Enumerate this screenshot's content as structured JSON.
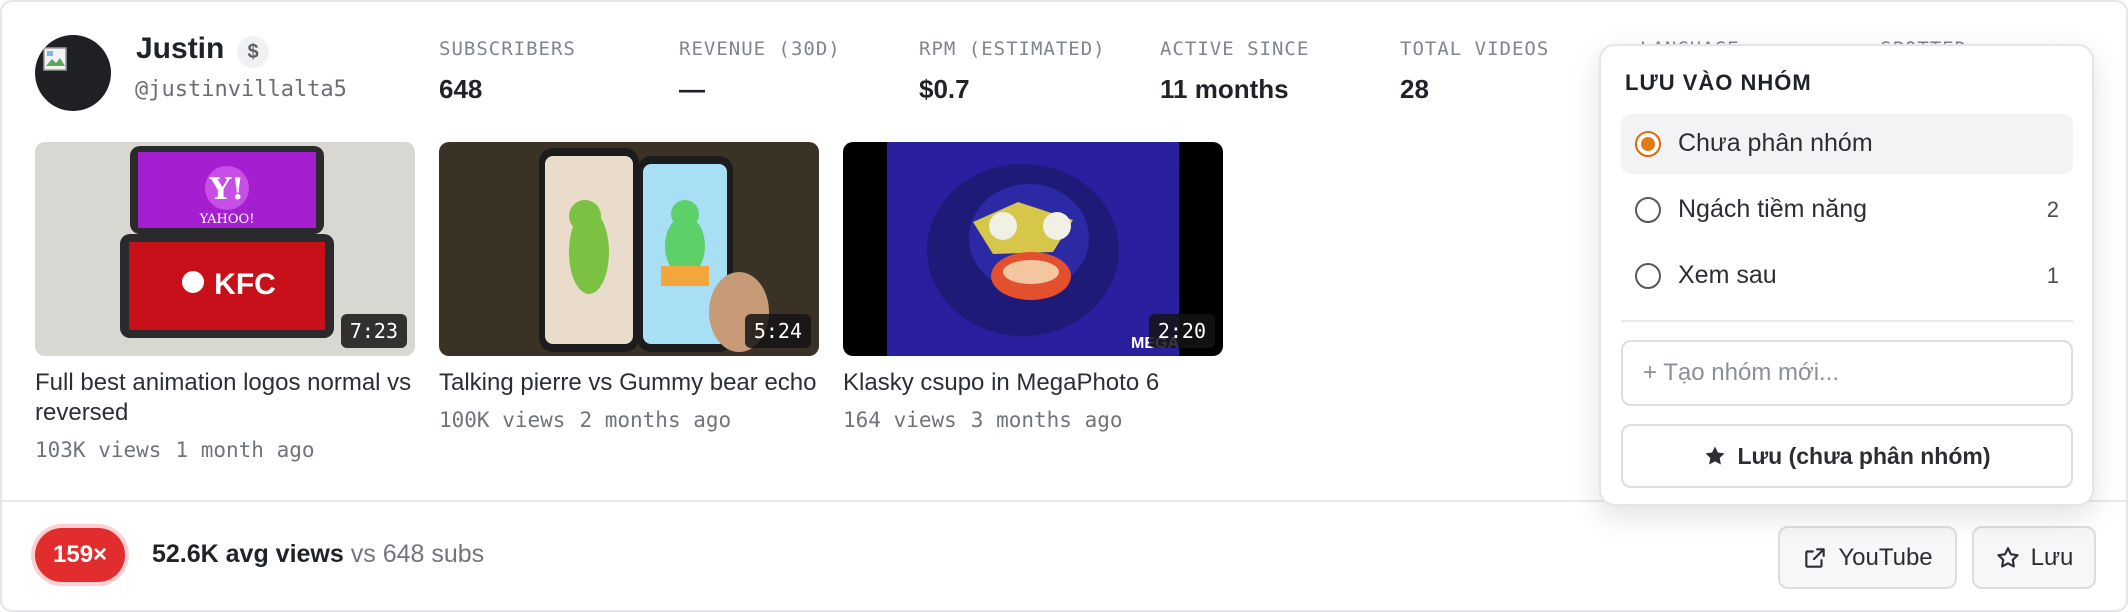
{
  "channel": {
    "name": "Justin",
    "badge_symbol": "$",
    "handle": "@justinvillalta5"
  },
  "stats": [
    {
      "label": "SUBSCRIBERS",
      "value": "648"
    },
    {
      "label": "REVENUE (30D)",
      "value": "—"
    },
    {
      "label": "RPM (ESTIMATED)",
      "value": "$0.7"
    },
    {
      "label": "ACTIVE SINCE",
      "value": "11 months"
    },
    {
      "label": "TOTAL VIDEOS",
      "value": "28"
    },
    {
      "label": "LANGUAGE",
      "value": ""
    },
    {
      "label": "SPOTTED",
      "value": ""
    }
  ],
  "videos": [
    {
      "title": "Full best animation logos normal vs reversed",
      "duration": "7:23",
      "views": "103K views",
      "age": "1 month ago"
    },
    {
      "title": "Talking pierre vs Gummy bear echo",
      "duration": "5:24",
      "views": "100K views",
      "age": "2 months ago"
    },
    {
      "title": "Klasky csupo in MegaPhoto 6",
      "duration": "2:20",
      "views": "164 views",
      "age": "3 months ago"
    }
  ],
  "footer": {
    "multiplier": "159×",
    "avg_views": "52.6K avg views",
    "vs_subs": "vs 648 subs",
    "youtube_label": "YouTube",
    "save_label": "Lưu"
  },
  "save_popover": {
    "title": "LƯU VÀO NHÓM",
    "options": [
      {
        "label": "Chưa phân nhóm",
        "count": "",
        "selected": true
      },
      {
        "label": "Ngách tiềm năng",
        "count": "2",
        "selected": false
      },
      {
        "label": "Xem sau",
        "count": "1",
        "selected": false
      }
    ],
    "new_group_placeholder": "+ Tạo nhóm mới...",
    "save_button_label": "Lưu (chưa phân nhóm)"
  },
  "colors": {
    "accent_radio": "#e07b14",
    "multiplier_badge": "#e12d2d"
  }
}
